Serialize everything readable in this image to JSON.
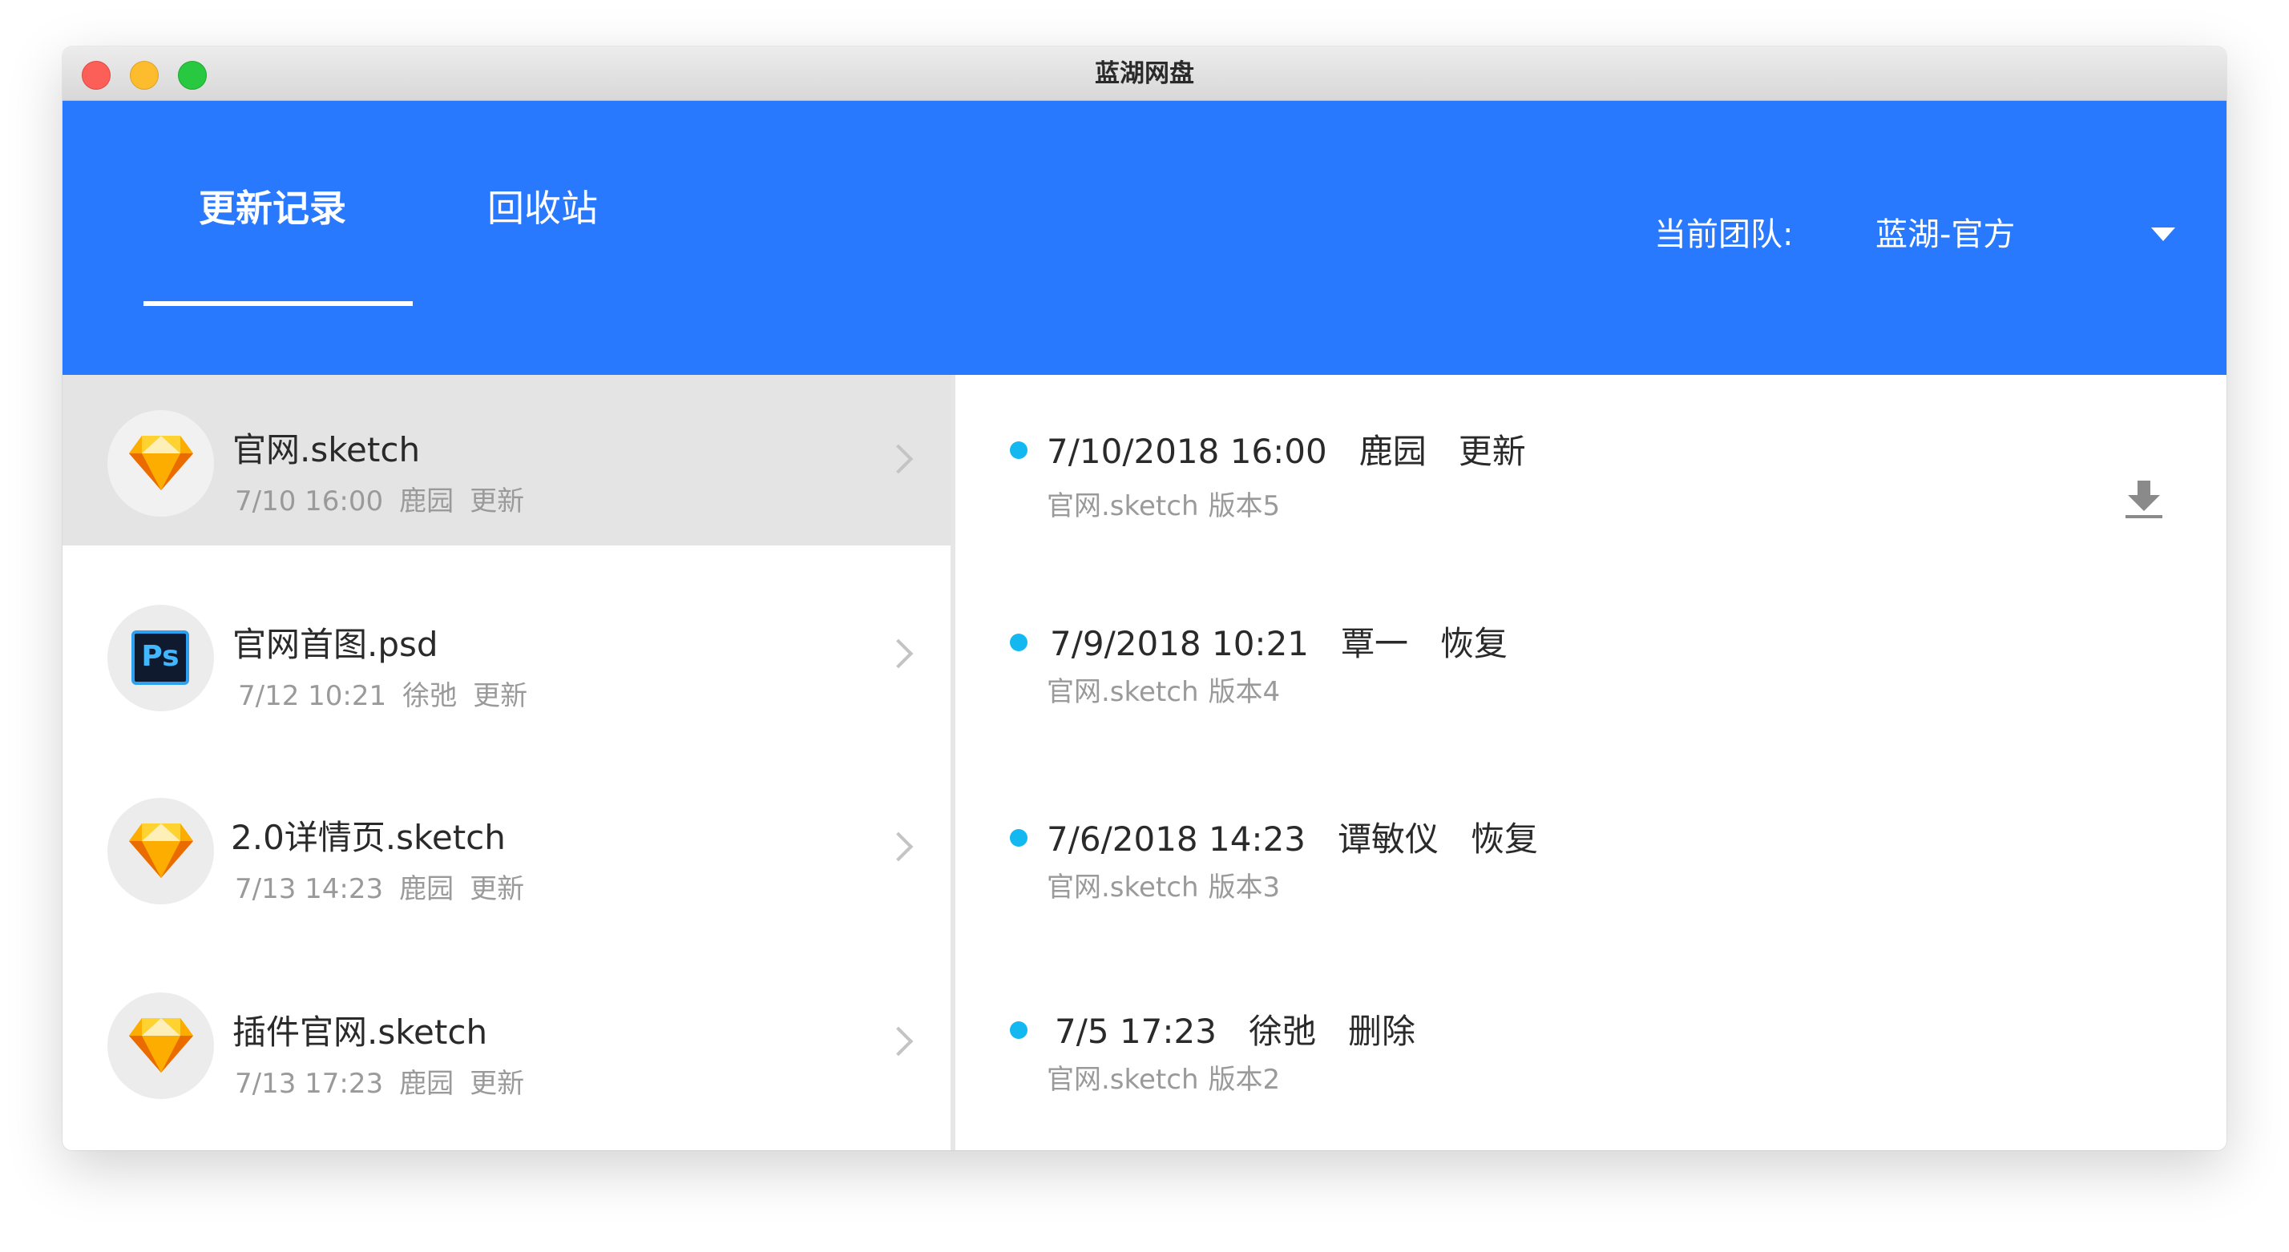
{
  "window": {
    "title": "蓝湖网盘",
    "traffic_lights": [
      "close",
      "minimize",
      "zoom"
    ]
  },
  "header": {
    "background_color": "#2979ff",
    "tabs": [
      {
        "label": "更新记录",
        "active": true
      },
      {
        "label": "回收站",
        "active": false
      }
    ],
    "team": {
      "label": "当前团队:",
      "value": "蓝湖-官方",
      "dropdown_icon": "caret-down-icon"
    }
  },
  "files": [
    {
      "name": "官网.sketch",
      "icon": "sketch-icon",
      "date": "7/10 16:00",
      "user": "鹿园",
      "action": "更新",
      "selected": true
    },
    {
      "name": "官网首图.psd",
      "icon": "photoshop-icon",
      "icon_text": "Ps",
      "date": "7/12 10:21",
      "user": "徐弛",
      "action": "更新",
      "selected": false
    },
    {
      "name": "2.0详情页.sketch",
      "icon": "sketch-icon",
      "date": "7/13 14:23",
      "user": "鹿园",
      "action": "更新",
      "selected": false
    },
    {
      "name": "插件官网.sketch",
      "icon": "sketch-icon",
      "date": "7/13 17:23",
      "user": "鹿园",
      "action": "更新",
      "selected": false
    }
  ],
  "history": [
    {
      "datetime": "7/10/2018 16:00",
      "user": "鹿园",
      "action": "更新",
      "file": "官网.sketch",
      "version": "版本5",
      "has_download": true
    },
    {
      "datetime": "7/9/2018 10:21",
      "user": "覃一",
      "action": "恢复",
      "file": "官网.sketch",
      "version": "版本4",
      "has_download": false
    },
    {
      "datetime": "7/6/2018 14:23",
      "user": "谭敏仪",
      "action": "恢复",
      "file": "官网.sketch",
      "version": "版本3",
      "has_download": false
    },
    {
      "datetime": "7/5 17:23",
      "user": "徐弛",
      "action": "删除",
      "file": "官网.sketch",
      "version": "版本2",
      "has_download": false
    }
  ],
  "colors": {
    "accent": "#2979ff",
    "dot": "#14b8f0",
    "selected_row": "#e4e4e4",
    "muted_text": "#9a9a9a"
  }
}
